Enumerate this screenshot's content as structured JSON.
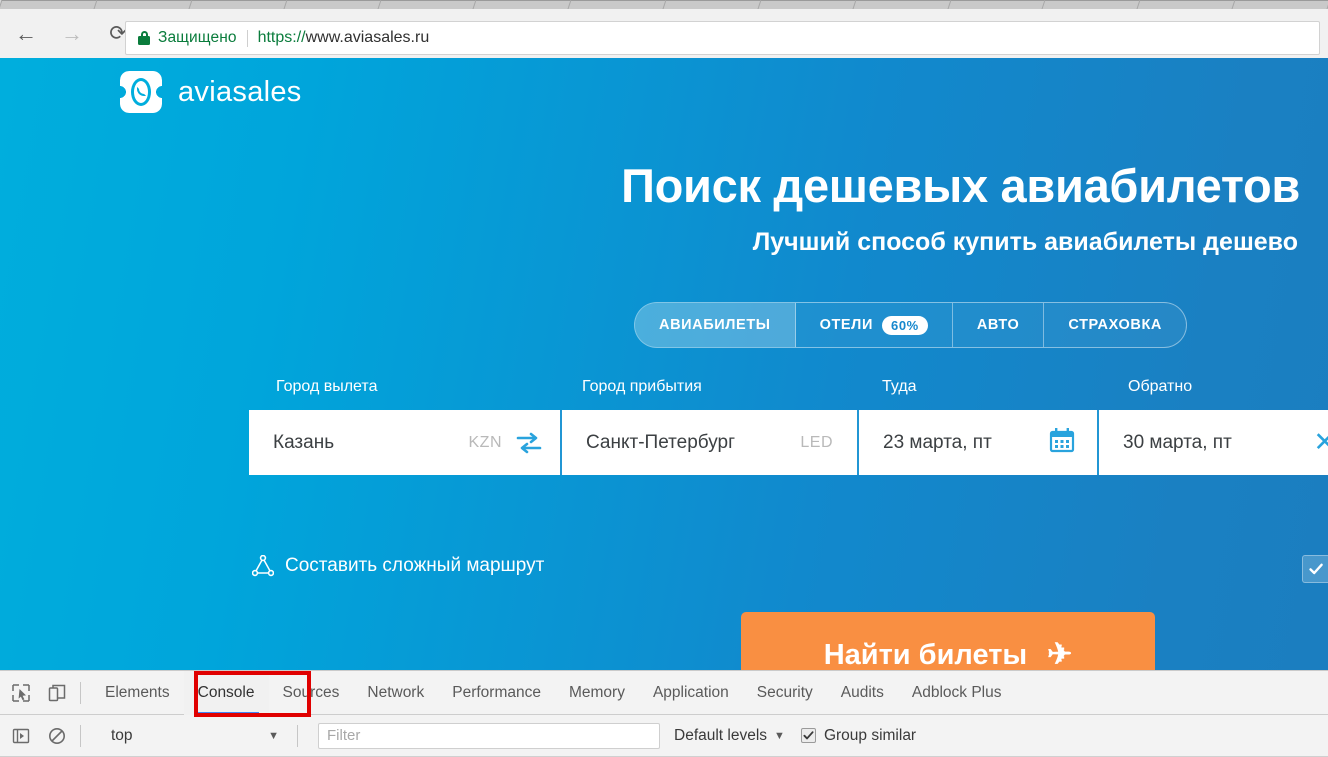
{
  "browser": {
    "back_icon": "back-arrow-icon",
    "forward_icon": "forward-arrow-icon",
    "reload_icon": "reload-icon",
    "security_label": "Защищено",
    "url_scheme": "https://",
    "url_rest": "www.aviasales.ru",
    "tab_count": 14
  },
  "page": {
    "brand_name": "aviasales",
    "headline": "Поиск дешевых авиабилетов",
    "subheadline": "Лучший способ купить авиабилеты дешево",
    "product_tabs": [
      {
        "label": "АВИАБИЛЕТЫ",
        "active": true,
        "badge": ""
      },
      {
        "label": "ОТЕЛИ",
        "active": false,
        "badge": "60%"
      },
      {
        "label": "АВТО",
        "active": false,
        "badge": ""
      },
      {
        "label": "СТРАХОВКА",
        "active": false,
        "badge": ""
      }
    ],
    "form": {
      "label_from": "Город вылета",
      "label_to": "Город прибытия",
      "label_there": "Туда",
      "label_back": "Обратно",
      "from_city": "Казань",
      "from_code": "KZN",
      "to_city": "Санкт-Петербург",
      "to_code": "LED",
      "date_there": "23 марта, пт",
      "date_back": "30 марта, пт"
    },
    "complex_route_label": "Составить сложный маршрут",
    "search_button_label": "Найти билеты",
    "search_button_icon": "✈",
    "colors": {
      "bg_left": "#00aedd",
      "bg_right": "#1b7ec0",
      "accent_orange": "#f98f42",
      "swap_blue": "#29a3dd"
    }
  },
  "devtools": {
    "tabs": [
      {
        "label": "Elements",
        "active": false
      },
      {
        "label": "Console",
        "active": true
      },
      {
        "label": "Sources",
        "active": false
      },
      {
        "label": "Network",
        "active": false
      },
      {
        "label": "Performance",
        "active": false
      },
      {
        "label": "Memory",
        "active": false
      },
      {
        "label": "Application",
        "active": false
      },
      {
        "label": "Security",
        "active": false
      },
      {
        "label": "Audits",
        "active": false
      },
      {
        "label": "Adblock Plus",
        "active": false
      }
    ],
    "console_bar": {
      "context": "top",
      "filter_value": "",
      "filter_placeholder": "Filter",
      "levels_label": "Default levels",
      "group_similar_label": "Group similar",
      "group_similar_checked": true
    },
    "highlight_color": "#e00000"
  }
}
